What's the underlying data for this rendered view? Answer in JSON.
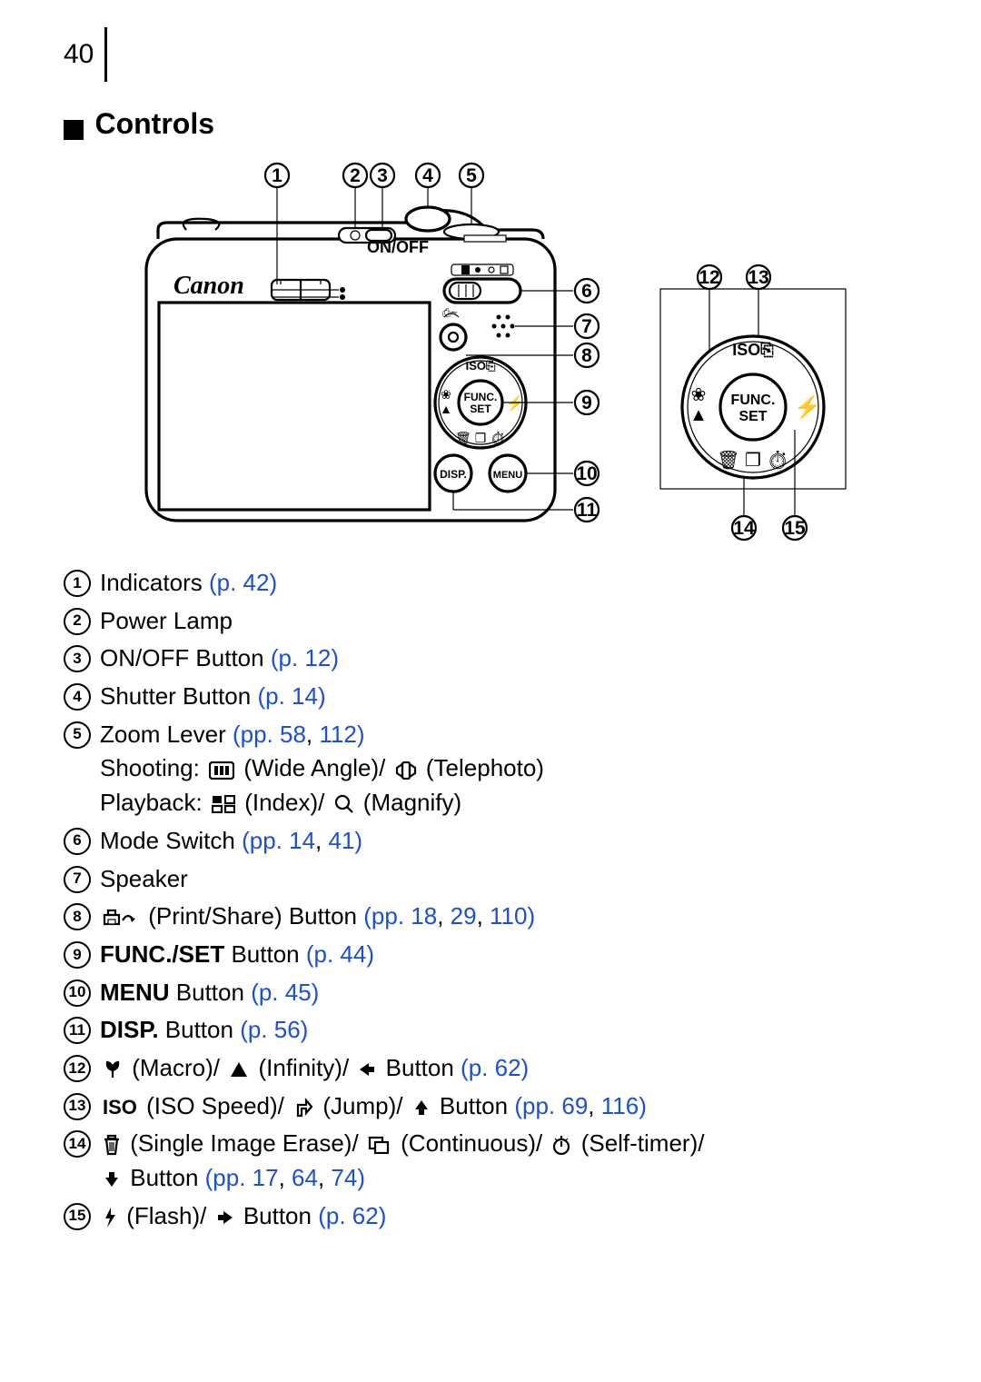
{
  "page_number": "40",
  "section_title": "Controls",
  "brand": "Canon",
  "callouts": [
    "1",
    "2",
    "3",
    "4",
    "5",
    "6",
    "7",
    "8",
    "9",
    "10",
    "11",
    "12",
    "13",
    "14",
    "15"
  ],
  "dial_labels": {
    "iso": "ISO",
    "func": "FUNC.",
    "set": "SET"
  },
  "btn_labels": {
    "disp": "DISP.",
    "menu": "MENU"
  },
  "icons": {
    "wide_angle": "wide-angle-icon",
    "telephoto": "telephoto-icon",
    "index": "index-icon",
    "magnify": "magnify-icon",
    "print_share": "print-share-icon",
    "macro": "macro-icon",
    "infinity": "infinity-icon",
    "left": "left-arrow-icon",
    "iso": "iso-icon",
    "jump": "jump-icon",
    "up": "up-arrow-icon",
    "erase": "erase-icon",
    "continuous": "continuous-icon",
    "selftimer": "self-timer-icon",
    "down": "down-arrow-icon",
    "flash": "flash-icon",
    "right": "right-arrow-icon"
  },
  "legend": {
    "i1": {
      "text": "Indicators ",
      "link": "(p. 42)"
    },
    "i2": {
      "text": "Power Lamp"
    },
    "i3": {
      "text": "ON/OFF Button ",
      "link": "(p. 12)"
    },
    "i4": {
      "text": "Shutter Button ",
      "link": "(p. 14)"
    },
    "i5": {
      "text": "Zoom Lever ",
      "ppword": "(pp. ",
      "l1": "58",
      "sep": ", ",
      "l2": "112",
      "close": ")",
      "sub1_pre": "Shooting: ",
      "sub1_mid": " (Wide Angle)/",
      "sub1_post": " (Telephoto)",
      "sub2_pre": "Playback: ",
      "sub2_mid": " (Index)/ ",
      "sub2_post": " (Magnify)"
    },
    "i6": {
      "text": "Mode Switch ",
      "ppword": "(pp. ",
      "l1": "14",
      "sep": ", ",
      "l2": "41",
      "close": ")"
    },
    "i7": {
      "text": "Speaker"
    },
    "i8": {
      "text": " (Print/Share) Button ",
      "ppword": "(pp. ",
      "l1": "18",
      "sep1": ", ",
      "l2": "29",
      "sep2": ", ",
      "l3": "110",
      "close": ")"
    },
    "i9": {
      "bold": "FUNC./SET",
      "text": " Button ",
      "link": "(p. 44)"
    },
    "i10": {
      "bold": "MENU",
      "text": " Button ",
      "link": "(p. 45)"
    },
    "i11": {
      "bold": "DISP.",
      "text": " Button ",
      "link": "(p. 56)"
    },
    "i12": {
      "t1": " (Macro)/",
      "t2": " (Infinity)/ ",
      "t3": " Button ",
      "link": "(p. 62)"
    },
    "i13": {
      "t1": " (ISO Speed)/",
      "t2": " (Jump)/ ",
      "t3": " Button ",
      "ppword": "(pp. ",
      "l1": "69",
      "sep": ", ",
      "l2": "116",
      "close": ")"
    },
    "i14": {
      "t1": " (Single Image Erase)/ ",
      "t2": " (Continuous)/ ",
      "t3": " (Self-timer)/",
      "t4": " Button ",
      "ppword": "(pp. ",
      "l1": "17",
      "sep1": ", ",
      "l2": "64",
      "sep2": ", ",
      "l3": "74",
      "close": ")"
    },
    "i15": {
      "t1": " (Flash)/ ",
      "t2": " Button ",
      "link": "(p. 62)"
    }
  }
}
